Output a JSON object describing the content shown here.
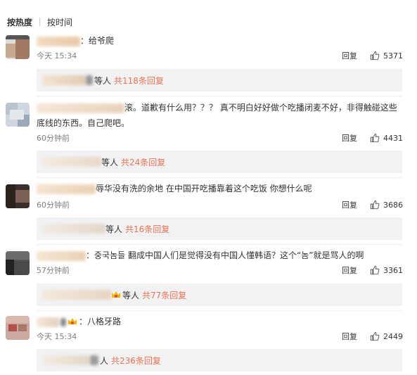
{
  "sort": {
    "hot": "按热度",
    "time": "按时间"
  },
  "reply_label": "回复",
  "comments": [
    {
      "text": "：给爷爬",
      "text2": "",
      "time": "今天 15:34",
      "likes": "5371",
      "sub_etc": "等人",
      "sub_total": "共118条回复"
    },
    {
      "text": "滚。道歉有什么用？？？ 真不明白好好做个吃播闭麦不好，非得触碰这些",
      "text2": "底线的东西。自己爬吧。",
      "time": "60分钟前",
      "likes": "4431",
      "sub_etc": "等人",
      "sub_total": "共24条回复"
    },
    {
      "text": "辱华没有洗的余地 在中国开吃播靠着这个吃饭 你想什么呢",
      "text2": "",
      "time": "60分钟前",
      "likes": "3686",
      "sub_etc": "等人",
      "sub_total": "共16条回复"
    },
    {
      "text": "：중국놈들 翻成中国人们是觉得没有中国人懂韩语？这个“놈”就是骂人的啊",
      "text2": "",
      "time": "57分钟前",
      "likes": "3361",
      "sub_etc": "等人",
      "sub_total": "共77条回复"
    },
    {
      "text": "：八格牙路",
      "text2": "",
      "time": "今天 15:34",
      "likes": "2449",
      "sub_etc": "人",
      "sub_total": "共236条回复"
    }
  ],
  "colors": {
    "accent": "#eb7350",
    "sub_bg": "#f2f2f5",
    "meta": "#808080"
  },
  "icons": {
    "like": "thumb-up-icon",
    "crown": "crown-icon"
  }
}
